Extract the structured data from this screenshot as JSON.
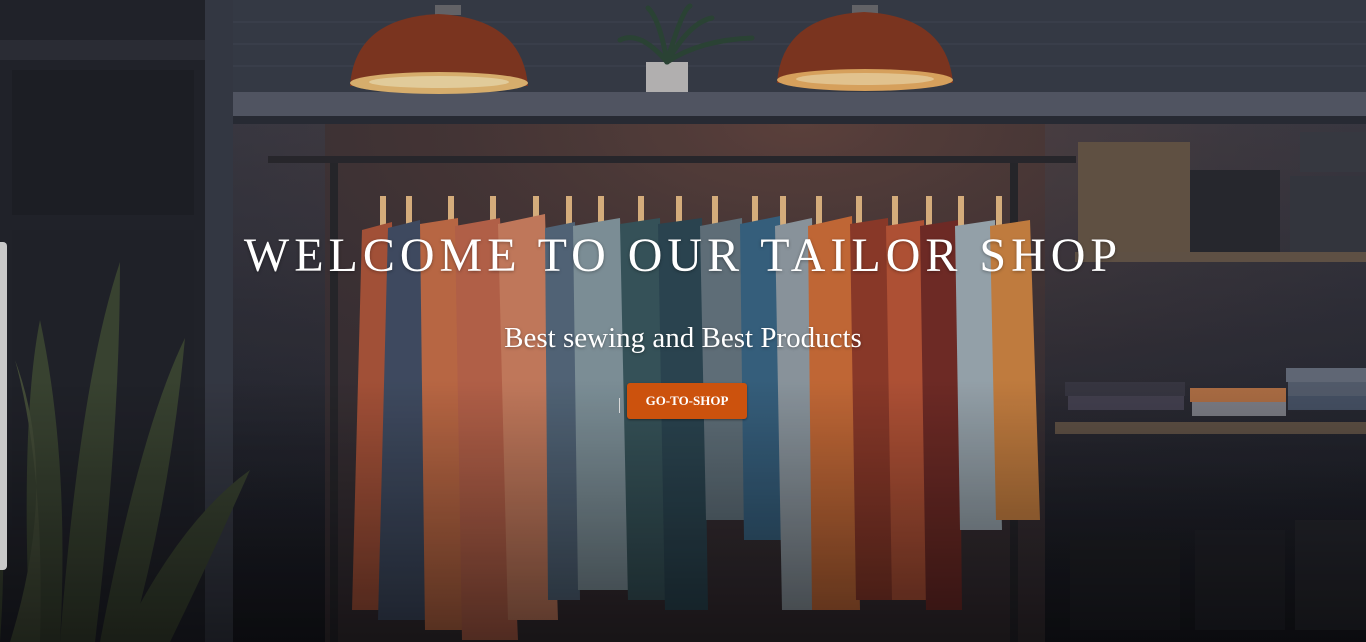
{
  "hero": {
    "title": "WELCOME TO OUR TAILOR SHOP",
    "subtitle": "Best sewing and Best Products",
    "button_label": "GO-TO-SHOP"
  },
  "colors": {
    "accent": "#cc520d",
    "text": "#ffffff"
  },
  "background": {
    "description_icons": [
      "pendant-lamp-icon",
      "plant-icon",
      "clothing-rack-icon",
      "folded-clothes-icon"
    ]
  }
}
